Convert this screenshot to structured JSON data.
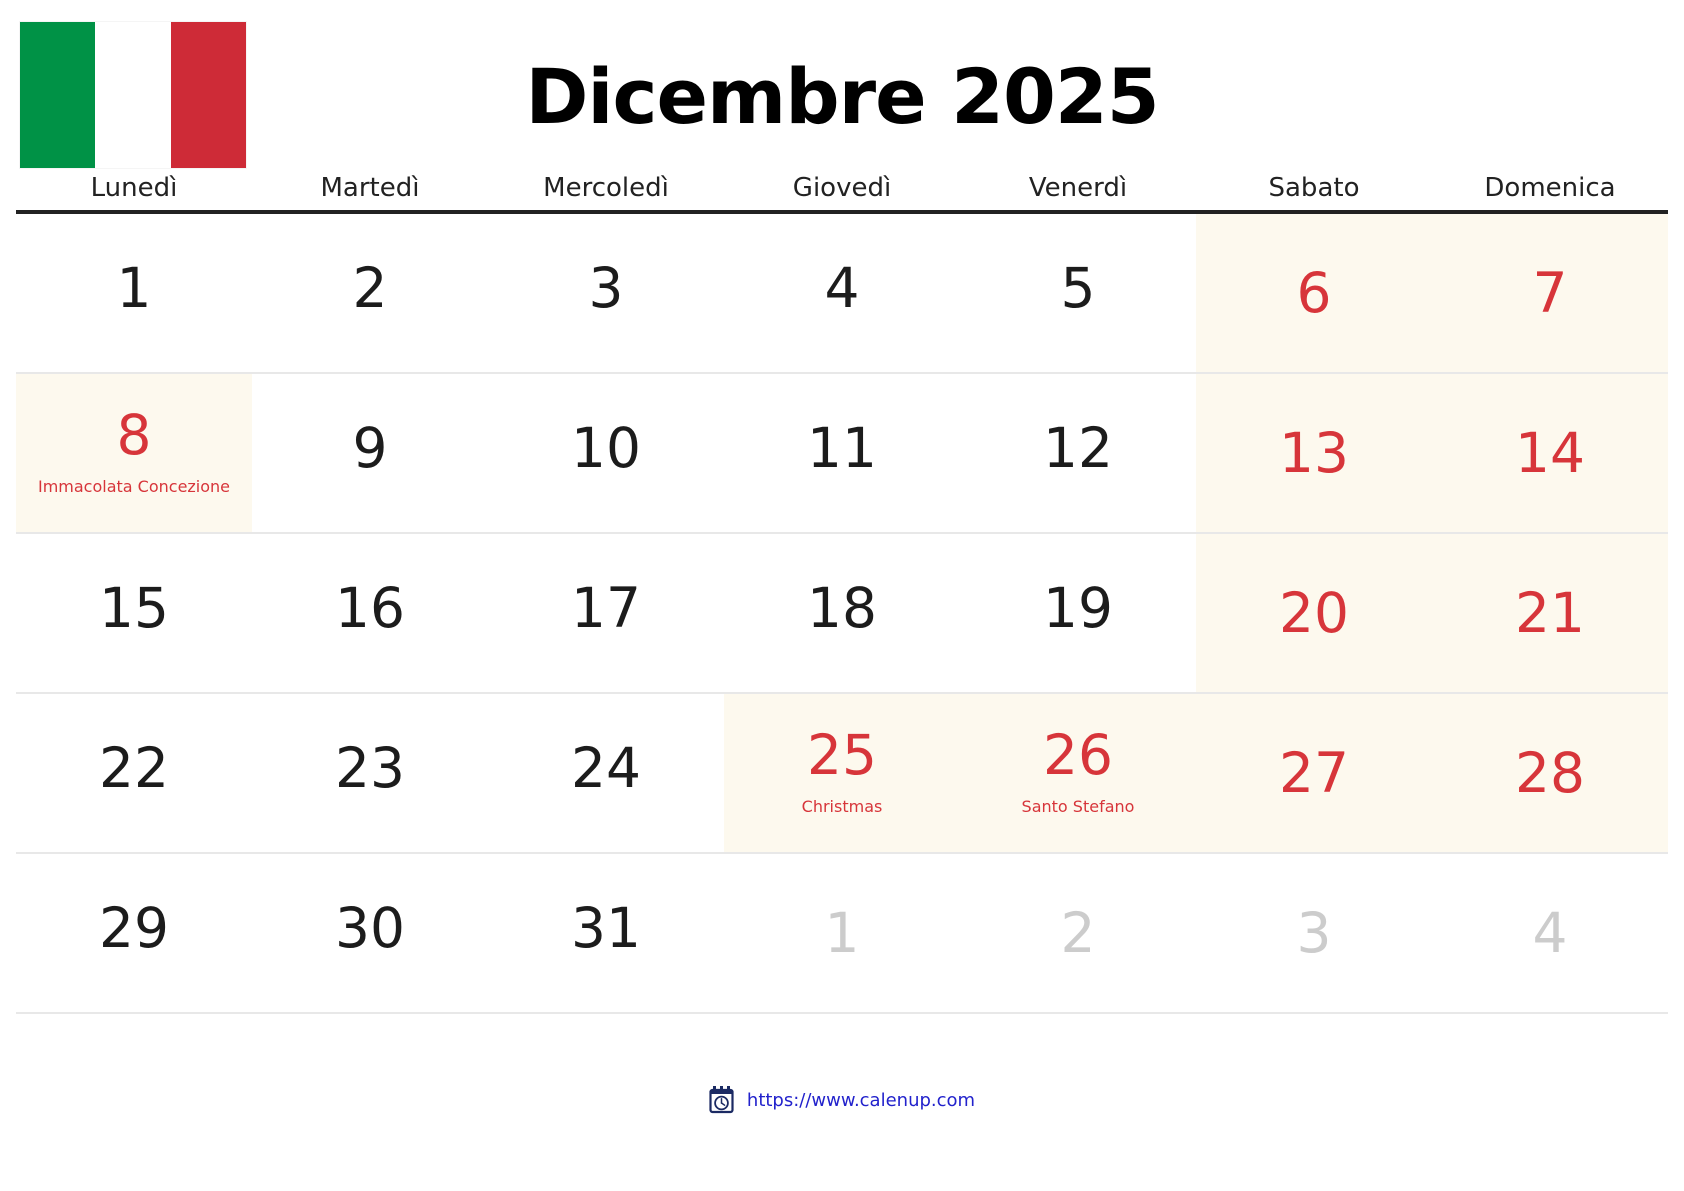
{
  "title": "Dicembre 2025",
  "locale": "it",
  "flag": {
    "name": "italy-flag",
    "bands": [
      "#009246",
      "#ffffff",
      "#ce2b37"
    ]
  },
  "colors": {
    "weekend_text": "#d7353a",
    "holiday_text": "#d7353a",
    "highlight_bg": "#fdf9ee",
    "weekday_text": "#222222",
    "other_month_text": "#cccccc",
    "link": "#2222cc"
  },
  "weekdays": [
    "Lunedì",
    "Martedì",
    "Mercoledì",
    "Giovedì",
    "Venerdì",
    "Sabato",
    "Domenica"
  ],
  "weeks": [
    [
      {
        "num": "1",
        "type": "weekday",
        "highlight": false,
        "label": ""
      },
      {
        "num": "2",
        "type": "weekday",
        "highlight": false,
        "label": ""
      },
      {
        "num": "3",
        "type": "weekday",
        "highlight": false,
        "label": ""
      },
      {
        "num": "4",
        "type": "weekday",
        "highlight": false,
        "label": ""
      },
      {
        "num": "5",
        "type": "weekday",
        "highlight": false,
        "label": ""
      },
      {
        "num": "6",
        "type": "weekend",
        "highlight": true,
        "label": ""
      },
      {
        "num": "7",
        "type": "weekend",
        "highlight": true,
        "label": ""
      }
    ],
    [
      {
        "num": "8",
        "type": "holiday",
        "highlight": true,
        "label": "Immacolata Concezione"
      },
      {
        "num": "9",
        "type": "weekday",
        "highlight": false,
        "label": ""
      },
      {
        "num": "10",
        "type": "weekday",
        "highlight": false,
        "label": ""
      },
      {
        "num": "11",
        "type": "weekday",
        "highlight": false,
        "label": ""
      },
      {
        "num": "12",
        "type": "weekday",
        "highlight": false,
        "label": ""
      },
      {
        "num": "13",
        "type": "weekend",
        "highlight": true,
        "label": ""
      },
      {
        "num": "14",
        "type": "weekend",
        "highlight": true,
        "label": ""
      }
    ],
    [
      {
        "num": "15",
        "type": "weekday",
        "highlight": false,
        "label": ""
      },
      {
        "num": "16",
        "type": "weekday",
        "highlight": false,
        "label": ""
      },
      {
        "num": "17",
        "type": "weekday",
        "highlight": false,
        "label": ""
      },
      {
        "num": "18",
        "type": "weekday",
        "highlight": false,
        "label": ""
      },
      {
        "num": "19",
        "type": "weekday",
        "highlight": false,
        "label": ""
      },
      {
        "num": "20",
        "type": "weekend",
        "highlight": true,
        "label": ""
      },
      {
        "num": "21",
        "type": "weekend",
        "highlight": true,
        "label": ""
      }
    ],
    [
      {
        "num": "22",
        "type": "weekday",
        "highlight": false,
        "label": ""
      },
      {
        "num": "23",
        "type": "weekday",
        "highlight": false,
        "label": ""
      },
      {
        "num": "24",
        "type": "weekday",
        "highlight": false,
        "label": ""
      },
      {
        "num": "25",
        "type": "holiday",
        "highlight": true,
        "label": "Christmas"
      },
      {
        "num": "26",
        "type": "holiday",
        "highlight": true,
        "label": "Santo Stefano"
      },
      {
        "num": "27",
        "type": "weekend",
        "highlight": true,
        "label": ""
      },
      {
        "num": "28",
        "type": "weekend",
        "highlight": true,
        "label": ""
      }
    ],
    [
      {
        "num": "29",
        "type": "weekday",
        "highlight": false,
        "label": ""
      },
      {
        "num": "30",
        "type": "weekday",
        "highlight": false,
        "label": ""
      },
      {
        "num": "31",
        "type": "weekday",
        "highlight": false,
        "label": ""
      },
      {
        "num": "1",
        "type": "other",
        "highlight": false,
        "label": ""
      },
      {
        "num": "2",
        "type": "other",
        "highlight": false,
        "label": ""
      },
      {
        "num": "3",
        "type": "other",
        "highlight": false,
        "label": ""
      },
      {
        "num": "4",
        "type": "other",
        "highlight": false,
        "label": ""
      }
    ]
  ],
  "footer": {
    "icon": "calendar-clock-icon",
    "url": "https://www.calenup.com"
  }
}
